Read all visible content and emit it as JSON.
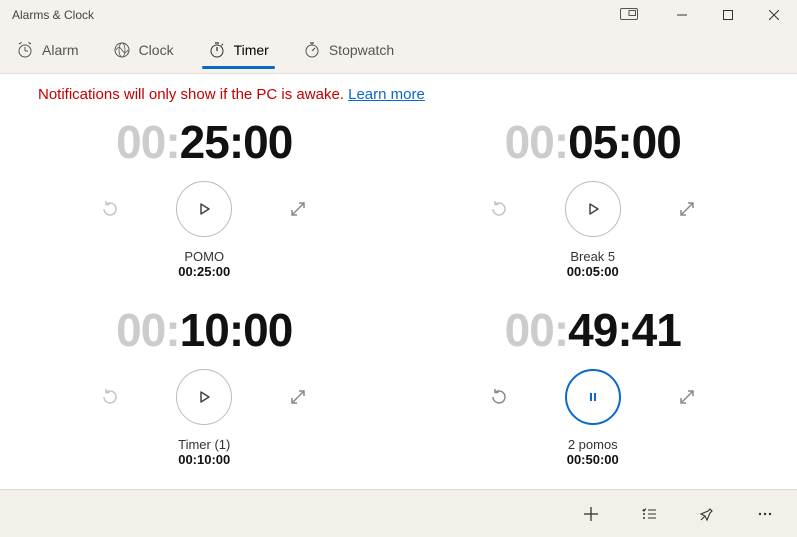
{
  "window": {
    "title": "Alarms & Clock"
  },
  "tabs": {
    "alarm": "Alarm",
    "clock": "Clock",
    "timer": "Timer",
    "stopwatch": "Stopwatch",
    "active": "timer"
  },
  "notice": {
    "text": "Notifications will only show if the PC is awake. ",
    "link": "Learn more"
  },
  "timers": [
    {
      "dim": "00:",
      "live": "25:00",
      "name": "POMO",
      "total": "00:25:00",
      "running": false
    },
    {
      "dim": "00:",
      "live": "05:00",
      "name": "Break 5",
      "total": "00:05:00",
      "running": false
    },
    {
      "dim": "00:",
      "live": "10:00",
      "name": "Timer (1)",
      "total": "00:10:00",
      "running": false
    },
    {
      "dim": "00:",
      "live": "49:41",
      "name": "2 pomos",
      "total": "00:50:00",
      "running": true
    }
  ]
}
